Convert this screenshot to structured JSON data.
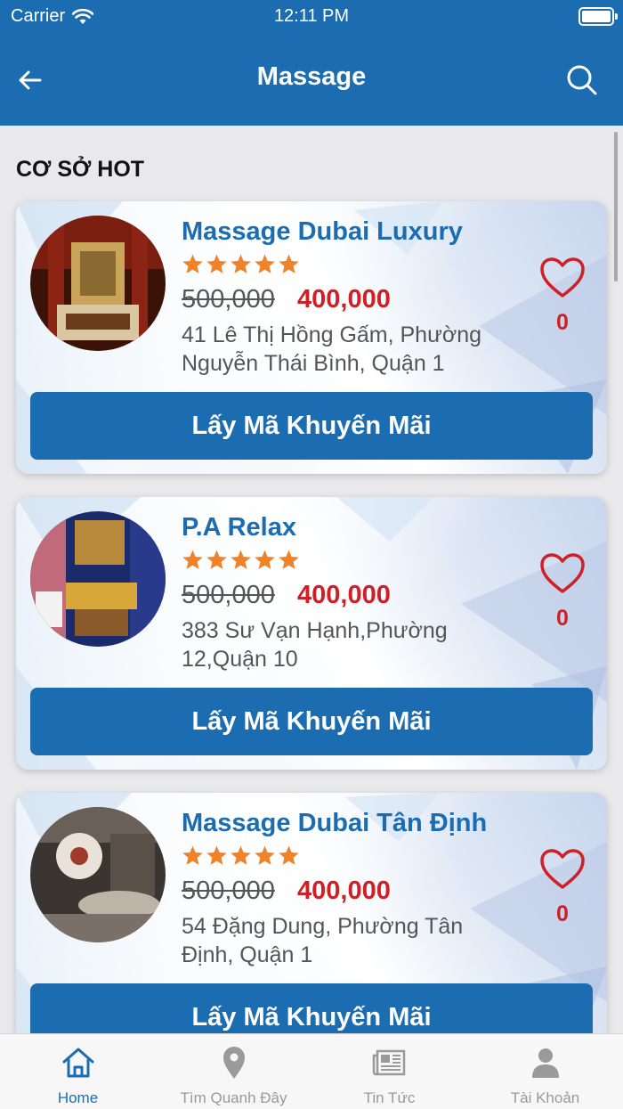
{
  "status_bar": {
    "carrier": "Carrier",
    "time": "12:11 PM"
  },
  "header": {
    "title": "Massage",
    "back_icon": "arrow-left-icon",
    "search_icon": "search-icon"
  },
  "section": {
    "title": "CƠ SỞ HOT"
  },
  "places": [
    {
      "name": "Massage Dubai Luxury",
      "rating": 5,
      "old_price": "500,000",
      "new_price": "400,000",
      "address": "41 Lê Thị Hồng Gấm, Phường Nguyễn Thái Bình, Quận 1",
      "likes": "0",
      "button": "Lấy Mã Khuyến Mãi"
    },
    {
      "name": "P.A Relax",
      "rating": 5,
      "old_price": "500,000",
      "new_price": "400,000",
      "address": "383 Sư Vạn Hạnh,Phường 12,Quận 10",
      "likes": "0",
      "button": "Lấy Mã Khuyến Mãi"
    },
    {
      "name": "Massage Dubai Tân Định",
      "rating": 5,
      "old_price": "500,000",
      "new_price": "400,000",
      "address": "54 Đặng Dung, Phường Tân Định, Quận 1",
      "likes": "0",
      "button": "Lấy Mã Khuyến Mãi"
    }
  ],
  "tabs": [
    {
      "label": "Home",
      "icon": "home-icon",
      "active": true
    },
    {
      "label": "Tìm Quanh Đây",
      "icon": "location-pin-icon",
      "active": false
    },
    {
      "label": "Tin Tức",
      "icon": "newspaper-icon",
      "active": false
    },
    {
      "label": "Tài Khoản",
      "icon": "person-icon",
      "active": false
    }
  ],
  "colors": {
    "primary": "#1b6cb0",
    "price_red": "#cf2027",
    "star_orange": "#f0822a",
    "background": "#e9e9ec"
  }
}
